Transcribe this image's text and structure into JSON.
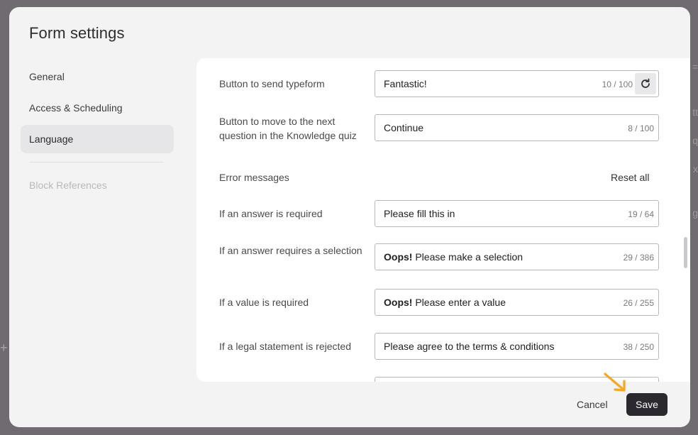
{
  "dialog": {
    "title": "Form settings"
  },
  "sidebar": {
    "items": [
      {
        "label": "General"
      },
      {
        "label": "Access & Scheduling"
      },
      {
        "label": "Language"
      },
      {
        "label": "Block References"
      }
    ],
    "active_item": "Language"
  },
  "settings": {
    "send_button": {
      "label": "Button to send typeform",
      "value": "Fantastic!",
      "count": "10 / 100"
    },
    "next_button": {
      "label": "Button to move to the next question in the Knowledge quiz",
      "value": "Continue",
      "count": "8 / 100"
    },
    "error_section": {
      "label": "Error messages",
      "reset_label": "Reset all"
    },
    "answer_required": {
      "label": "If an answer is required",
      "value": "Please fill this in",
      "count": "19 / 64"
    },
    "selection_required": {
      "label": "If an answer requires a selection",
      "value_bold": "Oops!",
      "value_rest": " Please make a selection",
      "count": "29 / 386"
    },
    "value_required": {
      "label": "If a value is required",
      "value_bold": "Oops!",
      "value_rest": " Please enter a value",
      "count": "26 / 255"
    },
    "legal_rejected": {
      "label": "If a legal statement is rejected",
      "value": "Please agree to the terms & conditions",
      "count": "38 / 250"
    }
  },
  "footer": {
    "cancel_label": "Cancel",
    "save_label": "Save"
  },
  "colors": {
    "save_button_bg": "#2b2830",
    "arrow_annotation": "#f5a623",
    "modal_bg": "#f4f3f4"
  },
  "icons": {
    "reset_field": "refresh-icon",
    "annotation": "arrow-icon"
  }
}
